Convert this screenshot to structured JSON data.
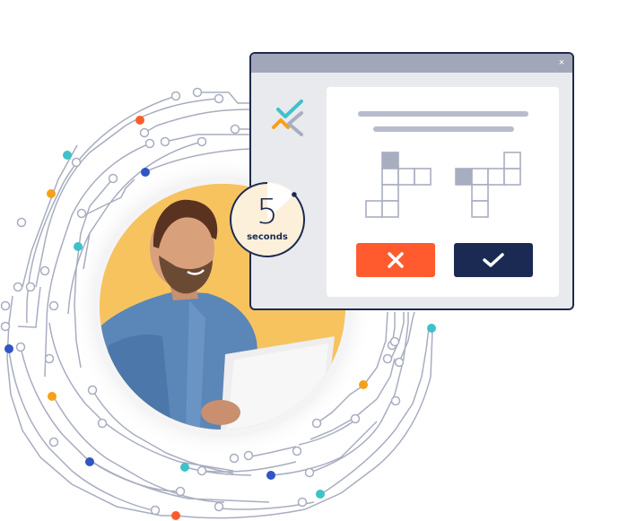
{
  "colors": {
    "navy": "#1b2a52",
    "orange": "#ff5b2e",
    "amber": "#f6a01a",
    "teal": "#3fc1c9",
    "blue": "#2f55c6",
    "circuit_line": "#a8adc0",
    "photo_bg": "#f6c35f",
    "window_bg": "#e9eaee",
    "titlebar": "#a2a6b9",
    "panel_bar": "#b8bbcb"
  },
  "window": {
    "close_icon": "×"
  },
  "timer": {
    "value": "5",
    "unit_label": "seconds",
    "remaining_fraction": 0.87
  },
  "puzzle": {
    "left_shape_highlight": "top",
    "right_shape_highlight": "left"
  },
  "actions": {
    "reject_icon": "close-x",
    "accept_icon": "checkmark"
  },
  "illustration": {
    "subject": "Smiling man in denim shirt using a laptop"
  }
}
